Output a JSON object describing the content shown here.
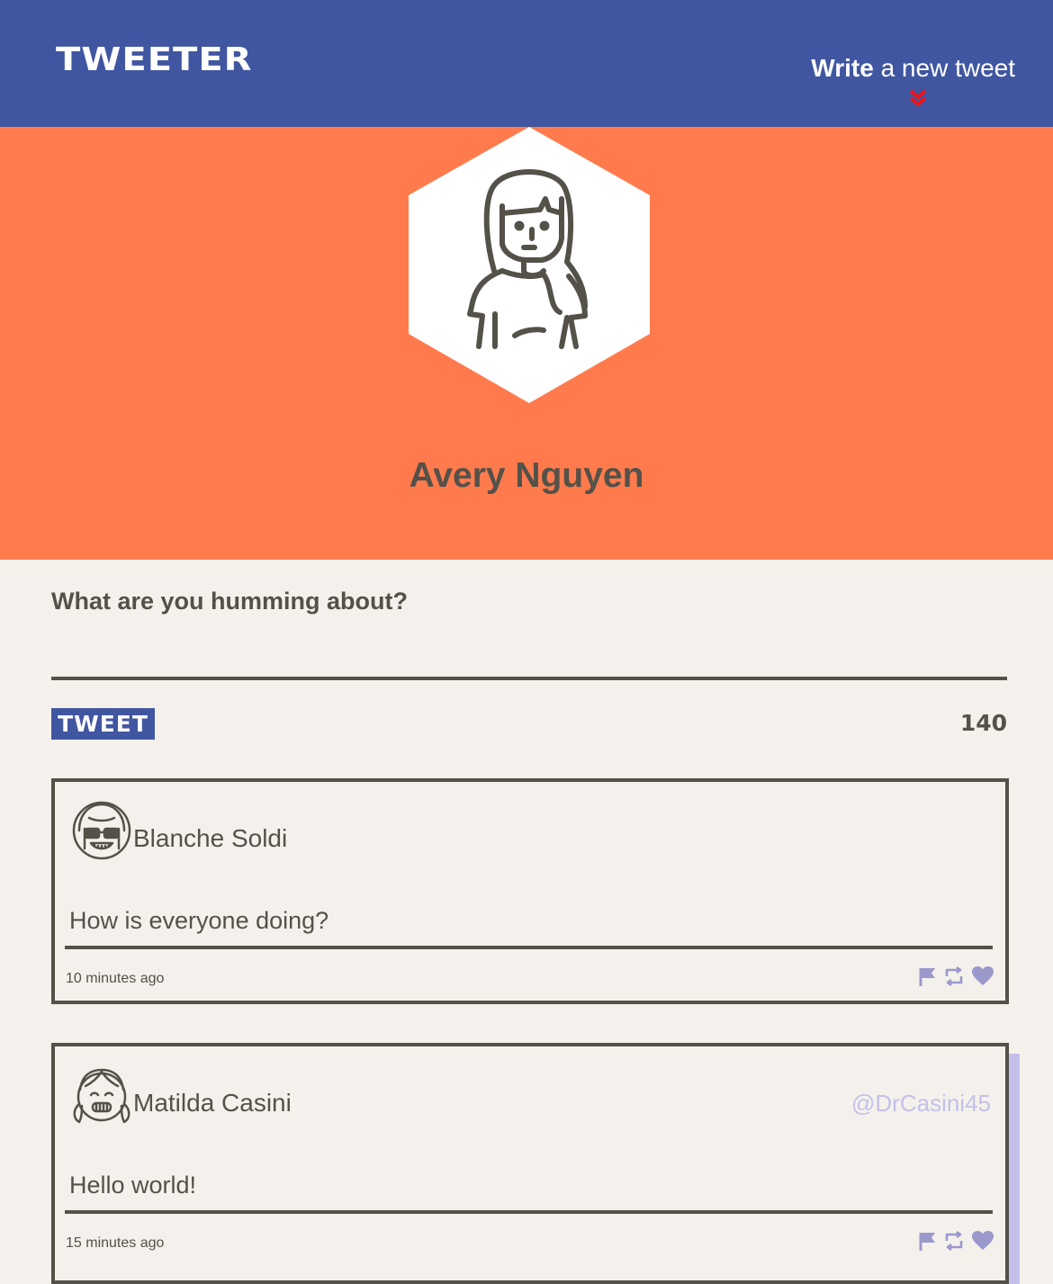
{
  "nav": {
    "brand": "TWEETER",
    "write_bold": "Write",
    "write_rest": " a new tweet"
  },
  "profile": {
    "name": "Avery Nguyen"
  },
  "compose": {
    "label": "What are you humming about?",
    "input_value": "",
    "button_label": "TWEET",
    "counter": "140"
  },
  "tweets": [
    {
      "author": "Blanche Soldi",
      "handle": "",
      "avatar_icon": "sunglasses-avatar-icon",
      "content": "How is everyone doing?",
      "time": "10 minutes ago",
      "actions": [
        "flag-icon",
        "retweet-icon",
        "heart-icon"
      ]
    },
    {
      "author": "Matilda Casini",
      "handle": "@DrCasini45",
      "avatar_icon": "pigtails-girl-avatar-icon",
      "content": "Hello world!",
      "time": "15 minutes ago",
      "actions": [
        "flag-icon",
        "retweet-icon",
        "heart-icon"
      ]
    }
  ],
  "colors": {
    "nav_bg": "#4056a1",
    "profile_bg": "#ff7b4d",
    "page_bg": "#f4f1ec",
    "text": "#545149",
    "accent_chevron": "#e8141c",
    "icon_muted": "#9b98cc",
    "hover_shadow": "#c4c0ea"
  }
}
